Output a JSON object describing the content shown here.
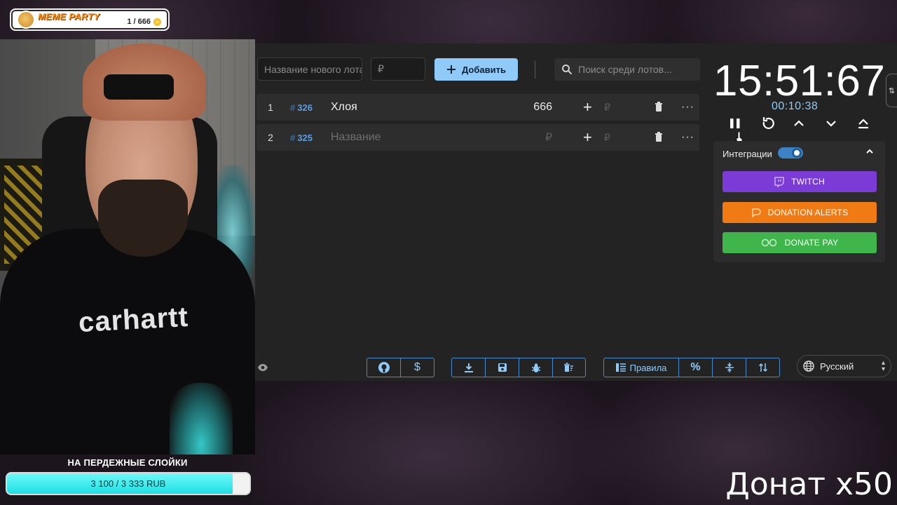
{
  "overlay": {
    "title": "MEME PARTY",
    "count": "1 / 666",
    "goal_title": "НА ПЕРДЕЖНЫЕ СЛОЙКИ",
    "goal_text": "3 100 / 3 333 RUB",
    "goal_progress": 0.93,
    "webcam_shirt_logo": "carhartt",
    "donate_banner": "Донат x50"
  },
  "toolbar": {
    "new_lot_placeholder": "Название нового лота",
    "amount_placeholder": "₽",
    "add_label": "Добавить",
    "search_placeholder": "Поиск среди лотов..."
  },
  "lots": [
    {
      "index": "1",
      "id": "326",
      "name": "Хлоя",
      "amount": "666",
      "add_placeholder": "₽"
    },
    {
      "index": "2",
      "id": "325",
      "name": "Название",
      "amount": "₽",
      "add_placeholder": "₽"
    }
  ],
  "bottom_bar": {
    "rules_label": "Правила",
    "language": "Русский"
  },
  "timer": {
    "main": "15:51:67",
    "elapsed": "00:10:38"
  },
  "integrations": {
    "label": "Интеграции",
    "enabled": true,
    "buttons": [
      {
        "label": "TWITCH",
        "color": "#7c3bd6"
      },
      {
        "label": "DONATION ALERTS",
        "color": "#f07b14"
      },
      {
        "label": "DONATE PAY",
        "color": "#3fb54c"
      }
    ]
  },
  "colors": {
    "accent": "#90caf9",
    "panel_bg": "#232323",
    "row_bg": "#2d2d2d"
  }
}
